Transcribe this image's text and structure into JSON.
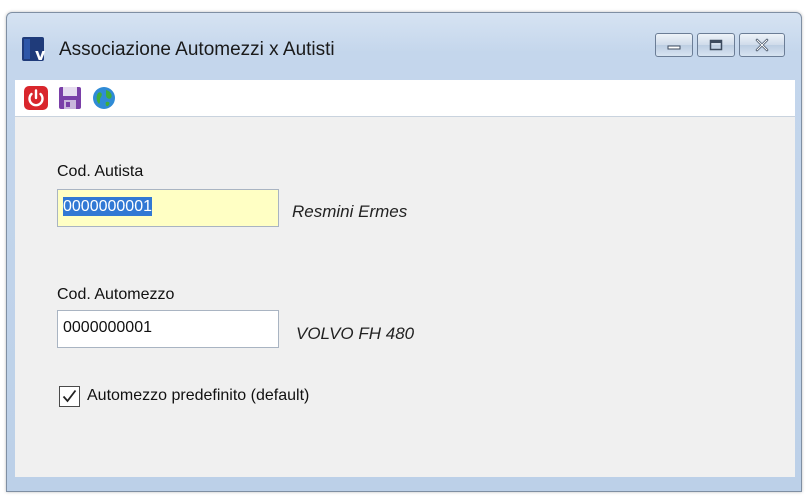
{
  "window": {
    "title": "Associazione Automezzi x Autisti",
    "icons": {
      "app": "v-logo-icon",
      "minimize": "minimize-icon",
      "maximize": "maximize-icon",
      "close": "close-icon"
    }
  },
  "toolbar": {
    "items": [
      {
        "icon": "power-icon",
        "color": "#d9262c"
      },
      {
        "icon": "save-icon",
        "color": "#7a3fa8"
      },
      {
        "icon": "globe-icon",
        "color": "#2f8bd6"
      }
    ]
  },
  "form": {
    "autista": {
      "label": "Cod. Autista",
      "value": "0000000001",
      "description": "Resmini Ermes"
    },
    "automezzo": {
      "label": "Cod. Automezzo",
      "value": "0000000001",
      "description": "VOLVO FH 480"
    },
    "default_checkbox": {
      "label": "Automezzo predefinito (default)",
      "checked": true
    }
  },
  "colors": {
    "focused_field": "#ffffc4",
    "selection": "#3178d4",
    "client_background": "#f0f0f0"
  }
}
